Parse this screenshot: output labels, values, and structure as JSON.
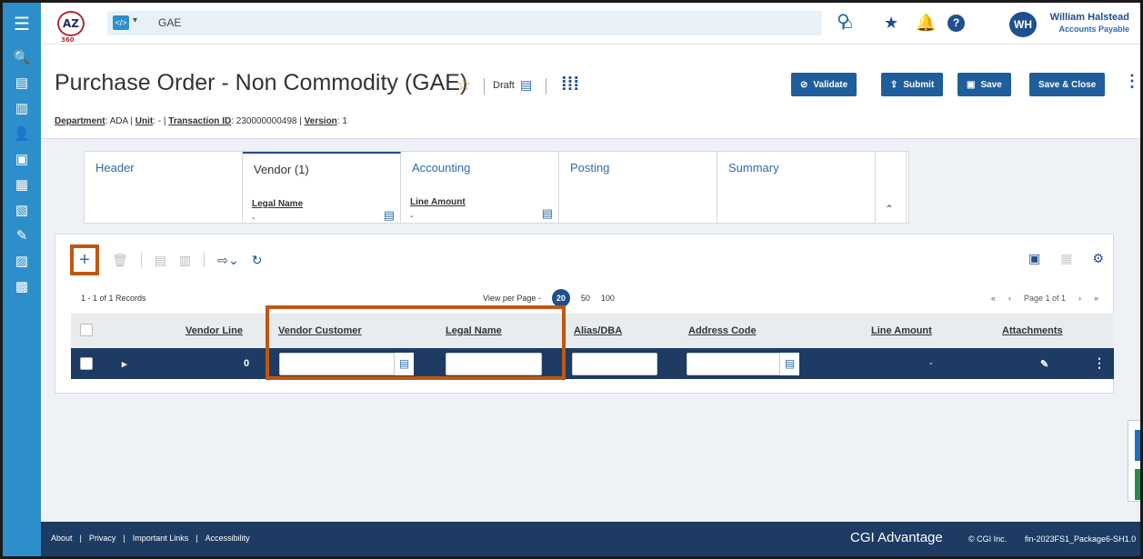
{
  "topbar": {
    "logo_text": "AZ",
    "logo_sub": "360",
    "context_value": "GAE",
    "user_initials": "WH",
    "user_name": "William Halstead",
    "user_role": "Accounts Payable"
  },
  "page": {
    "title": "Purchase Order - Non Commodity (GAE)",
    "status": "Draft",
    "meta": [
      {
        "label": "Department",
        "value": "ADA"
      },
      {
        "label": "Unit",
        "value": "-"
      },
      {
        "label": "Transaction ID",
        "value": "230000000498"
      },
      {
        "label": "Version",
        "value": "1"
      }
    ]
  },
  "actions": {
    "validate": "Validate",
    "submit": "Submit",
    "save": "Save",
    "save_close": "Save & Close"
  },
  "tabs": [
    {
      "label": "Header",
      "sublabel": "",
      "subvalue": ""
    },
    {
      "label": "Vendor (1)",
      "sublabel": "Legal Name",
      "subvalue": "-"
    },
    {
      "label": "Accounting",
      "sublabel": "Line Amount",
      "subvalue": "-"
    },
    {
      "label": "Posting",
      "sublabel": "",
      "subvalue": ""
    },
    {
      "label": "Summary",
      "sublabel": "",
      "subvalue": ""
    }
  ],
  "grid": {
    "records": "1 - 1 of 1 Records",
    "view_per_page_label": "View per Page -",
    "page_sizes": [
      "20",
      "50",
      "100"
    ],
    "selected_page_size": "20",
    "pager_text": "Page 1 of 1",
    "columns": [
      "Vendor Line",
      "Vendor Customer",
      "Legal Name",
      "Alias/DBA",
      "Address Code",
      "Line Amount",
      "Attachments"
    ],
    "row": {
      "vendor_line": "0",
      "vendor_customer": "",
      "legal_name": "",
      "alias_dba": "",
      "address_code": "",
      "line_amount": "-"
    }
  },
  "footer": {
    "links": [
      "About",
      "Privacy",
      "Important Links",
      "Accessibility"
    ],
    "brand": "CGI Advantage",
    "copyright": "© CGI Inc.",
    "package": "fin-2023FS1_Package6-SH1.0"
  },
  "colors": {
    "nav": "#2d8fc9",
    "primary": "#1f5d9c",
    "row_selected": "#1d3b63",
    "highlight": "#c0570f"
  }
}
